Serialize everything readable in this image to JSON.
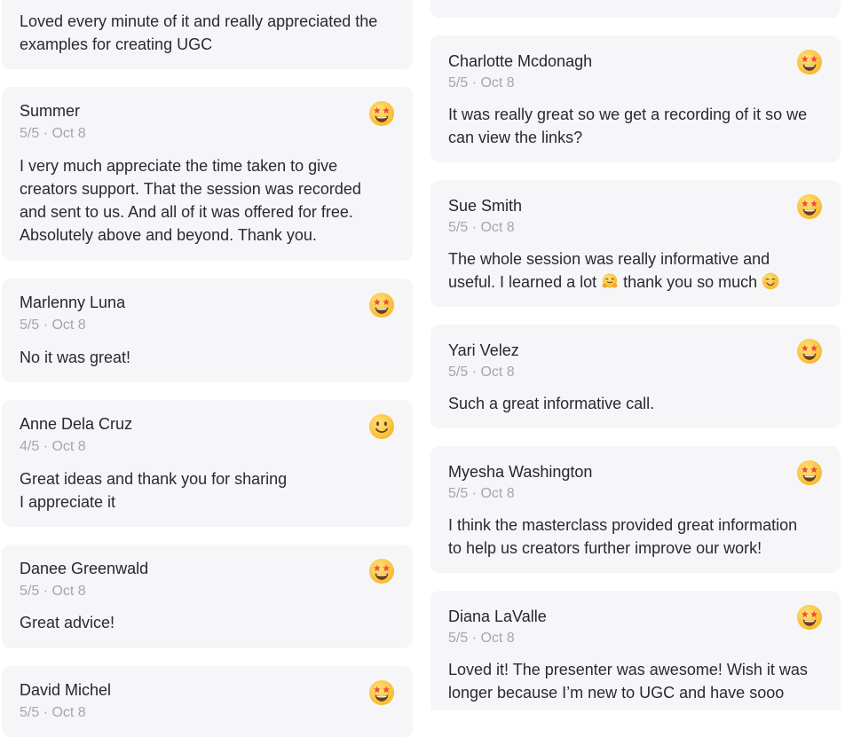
{
  "left_column": [
    {
      "name": "",
      "meta": "",
      "text_lines": [
        "Loved every minute of it and really appreciated the",
        "examples for creating UGC"
      ],
      "emoji": "none"
    },
    {
      "name": "Summer",
      "meta": "5/5 · Oct 8",
      "text_lines": [
        "I very much appreciate the time taken to give",
        "creators support. That the session was recorded",
        "and sent to us. And all of it was offered for free.",
        "Absolutely above and beyond. Thank you."
      ],
      "emoji": "star-struck-icon"
    },
    {
      "name": "Marlenny Luna",
      "meta": "5/5 · Oct 8",
      "text_lines": [
        "No it was great!"
      ],
      "emoji": "star-struck-icon"
    },
    {
      "name": "Anne Dela Cruz",
      "meta": "4/5 · Oct 8",
      "text_lines": [
        "Great ideas and thank you for sharing",
        "I appreciate it"
      ],
      "emoji": "slightly-smiling-face-icon"
    },
    {
      "name": "Danee Greenwald",
      "meta": "5/5 · Oct 8",
      "text_lines": [
        "Great advice!"
      ],
      "emoji": "star-struck-icon"
    },
    {
      "name": "David Michel",
      "meta": "5/5 · Oct 8",
      "text_lines": [],
      "emoji": "star-struck-icon"
    }
  ],
  "right_column": [
    {
      "name": "Charlotte Mcdonagh",
      "meta": "5/5 · Oct 8",
      "text_lines": [
        "It was really great so we get a recording of it so we",
        "can view the links?"
      ],
      "emoji": "star-struck-icon"
    },
    {
      "name": "Sue Smith",
      "meta": "5/5 · Oct 8",
      "text_lines": [
        "The whole session was really informative and"
      ],
      "text_line2": {
        "a": "useful. I learned a lot ",
        "b": " thank you so much "
      },
      "emoji": "star-struck-icon"
    },
    {
      "name": "Yari Velez",
      "meta": "5/5 · Oct 8",
      "text_lines": [
        "Such a great informative call."
      ],
      "emoji": "star-struck-icon"
    },
    {
      "name": "Myesha Washington",
      "meta": "5/5 · Oct 8",
      "text_lines": [
        "I think the masterclass provided great information",
        "to help us creators further improve our work!"
      ],
      "emoji": "star-struck-icon"
    },
    {
      "name": "Diana LaValle",
      "meta": "5/5 · Oct 8",
      "text_lines": [
        "Loved it! The presenter was awesome! Wish it was",
        "longer because I’m new to UGC and have sooo"
      ],
      "emoji": "star-struck-icon"
    }
  ],
  "colors": {
    "card_bg": "#f6f6f8",
    "meta_text": "#a5a6ad",
    "emoji_yellow": "#fbc73a"
  }
}
